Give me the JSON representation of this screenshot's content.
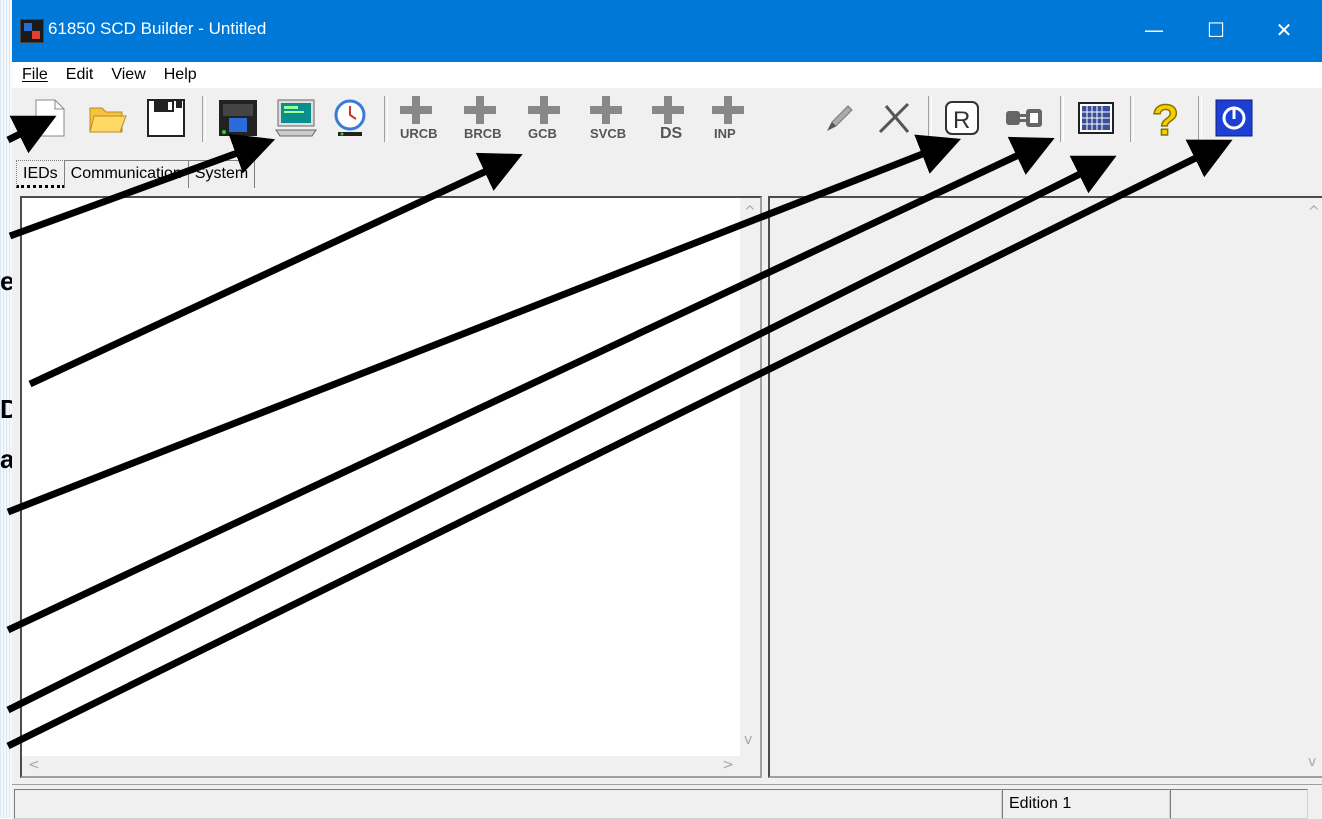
{
  "window": {
    "title": "61850 SCD Builder - Untitled",
    "minimize": "—",
    "maximize": "☐",
    "close": "✕"
  },
  "menu": [
    "File",
    "Edit",
    "View",
    "Help"
  ],
  "toolbar": {
    "cb_labels": {
      "urcb": "URCB",
      "brcb": "BRCB",
      "gcb": "GCB",
      "svcb": "SVCB",
      "ds": "DS",
      "inp": "INP"
    },
    "r_label": "R"
  },
  "tabs": [
    "IEDs",
    "Communication",
    "System"
  ],
  "status": {
    "edition": "Edition 1"
  },
  "margin_text": [
    "e",
    "D",
    "a"
  ]
}
